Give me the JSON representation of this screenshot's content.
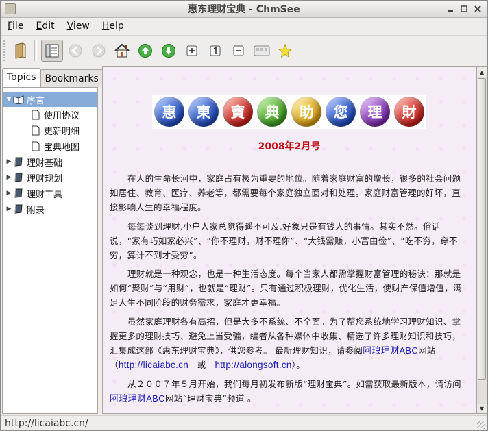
{
  "window": {
    "title": "惠东理财宝典 - ChmSee",
    "controls": [
      "minimize-icon",
      "maximize-icon",
      "close-icon"
    ]
  },
  "menubar": [
    {
      "label": "File",
      "mnemonic": "F"
    },
    {
      "label": "Edit",
      "mnemonic": "E"
    },
    {
      "label": "View",
      "mnemonic": "V"
    },
    {
      "label": "Help",
      "mnemonic": "H"
    }
  ],
  "toolbar": {
    "buttons": [
      {
        "name": "open-book-icon"
      },
      {
        "name": "sidebar-toggle-icon",
        "state": "pressed"
      },
      {
        "name": "back-icon",
        "state": "disabled"
      },
      {
        "name": "forward-icon",
        "state": "disabled"
      },
      {
        "name": "home-icon"
      },
      {
        "name": "previous-page-icon"
      },
      {
        "name": "next-page-icon"
      },
      {
        "name": "zoom-in-icon"
      },
      {
        "name": "zoom-reset-icon"
      },
      {
        "name": "zoom-out-icon"
      },
      {
        "name": "fullscreen-icon"
      },
      {
        "name": "bookmark-star-icon"
      }
    ]
  },
  "sidebar": {
    "tabs": [
      {
        "label": "Topics",
        "active": true
      },
      {
        "label": "Bookmarks",
        "active": false
      }
    ],
    "tree": [
      {
        "label": "序言",
        "level": 0,
        "expanded": true,
        "selected": true
      },
      {
        "label": "使用协议",
        "level": 1
      },
      {
        "label": "更新明细",
        "level": 1
      },
      {
        "label": "宝典地图",
        "level": 1
      },
      {
        "label": "理财基础",
        "level": 0,
        "expanded": false
      },
      {
        "label": "理财规划",
        "level": 0,
        "expanded": false
      },
      {
        "label": "理财工具",
        "level": 0,
        "expanded": false
      },
      {
        "label": "附录",
        "level": 0,
        "expanded": false
      }
    ]
  },
  "content": {
    "banner": {
      "chars": [
        "惠",
        "東",
        "寶",
        "典",
        "助",
        "您",
        "理",
        "財"
      ],
      "colors": [
        "#2b56c9",
        "#2b56c9",
        "#d62b24",
        "#4aa82a",
        "#e3b31c",
        "#2b56c9",
        "#8a3bb8",
        "#d62b24"
      ]
    },
    "date": "2008年2月号",
    "p1": "在人的生命长河中，家庭占有极为重要的地位。随着家庭财富的增长，很多的社会问题如居住、教育、医疗、养老等，都需要每个家庭独立面对和处理。家庭财富管理的好坏，直接影响人生的幸福程度。",
    "p2": "每每谈到理财,小户人家总觉得遥不可及,好象只是有钱人的事情。其实不然。俗话说，“家有巧如家必兴”、“你不理财，财不理你”、“大钱需赚，小富由俭”、“吃不穷，穿不穷，算计不到才受穷”。",
    "p3": "理财就是一种观念，也是一种生活态度。每个当家人都需掌握财富管理的秘诀：那就是如何“聚财”与“用财”，也就是“理财”。只有通过积极理财，优化生活，使财产保值增值，满足人生不同阶段的财务需求，家庭才更幸福。",
    "p4_a": "虽然家庭理财各有高招，但是大多不系统、不全面。为了帮您系统地学习理财知识、掌握更多的理财技巧、避免上当受骗，编者从各种媒体中收集、精选了许多理财知识和技巧，汇集成这部《惠东理财宝典》，供您参考。 最新理财知识，请参阅",
    "p4_link": "阿琅理财",
    "p4_abc": "ABC",
    "p4_b": "网站",
    "p4_paren_open": "（",
    "url1": "http://licaiabc.cn",
    "p4_or": "或",
    "url2": "http://alongsoft.cn",
    "p4_end": "）。",
    "p5_a": "从２００７年５月开始，我们每月初发布新版“理财宝典”。如需获取最新版本，请访问",
    "p5_link": "阿琅理财",
    "p5_abc": "ABC",
    "p5_b": "网站“理财宝典”频道 。"
  },
  "statusbar": {
    "text": "http://licaiabc.cn/"
  }
}
